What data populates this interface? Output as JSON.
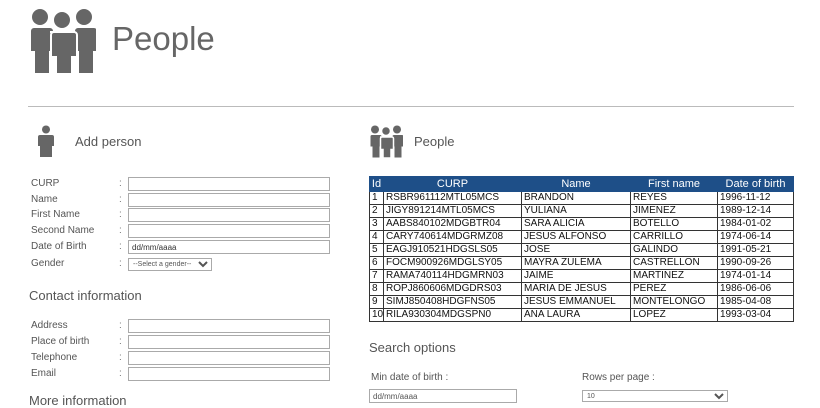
{
  "header": {
    "title": "People"
  },
  "add_person": {
    "title": "Add person",
    "fields": [
      {
        "label": "CURP",
        "value": ""
      },
      {
        "label": "Name",
        "value": ""
      },
      {
        "label": "First Name",
        "value": ""
      },
      {
        "label": "Second Name",
        "value": ""
      },
      {
        "label": "Date of Birth",
        "value": "dd/mm/aaaa"
      }
    ],
    "gender": {
      "label": "Gender",
      "selected": "--Select a gender--"
    }
  },
  "contact": {
    "title": "Contact information",
    "fields": [
      {
        "label": "Address"
      },
      {
        "label": "Place of birth"
      },
      {
        "label": "Telephone"
      },
      {
        "label": "Email"
      }
    ]
  },
  "more_info": {
    "title": "More information"
  },
  "people_panel": {
    "title": "People",
    "columns": [
      "Id",
      "CURP",
      "Name",
      "First name",
      "Date of birth"
    ],
    "rows": [
      [
        "1",
        "RSBR961112MTL05MCS",
        "BRANDON",
        "REYES",
        "1996-11-12"
      ],
      [
        "2",
        "JIGY891214MTL05MCS",
        "YULIANA",
        "JIMENEZ",
        "1989-12-14"
      ],
      [
        "3",
        "AABS840102MDGBTR04",
        "SARA ALICIA",
        "BOTELLO",
        "1984-01-02"
      ],
      [
        "4",
        "CARY740614MDGRMZ08",
        "JESUS ALFONSO",
        "CARRILLO",
        "1974-06-14"
      ],
      [
        "5",
        "EAGJ910521HDGSLS05",
        "JOSE",
        "GALINDO",
        "1991-05-21"
      ],
      [
        "6",
        "FOCM900926MDGLSY05",
        "MAYRA ZULEMA",
        "CASTRELLON",
        "1990-09-26"
      ],
      [
        "7",
        "RAMA740114HDGMRN03",
        "JAIME",
        "MARTINEZ",
        "1974-01-14"
      ],
      [
        "8",
        "ROPJ860606MDGDRS03",
        "MARIA DE JESUS",
        "PEREZ",
        "1986-06-06"
      ],
      [
        "9",
        "SIMJ850408HDGFNS05",
        "JESUS EMMANUEL",
        "MONTELONGO",
        "1985-04-08"
      ],
      [
        "10",
        "RILA930304MDGSPN0",
        "ANA LAURA",
        "LOPEZ",
        "1993-03-04"
      ]
    ]
  },
  "search": {
    "title": "Search options",
    "min_dob_label": "Min date of birth :",
    "min_dob_value": "dd/mm/aaaa",
    "rows_label": "Rows per page :",
    "rows_value": "10"
  },
  "colors": {
    "table_header": "#1e4f88",
    "text": "#555555"
  },
  "icons": [
    "people-group-icon",
    "person-icon",
    "people-group-icon"
  ]
}
